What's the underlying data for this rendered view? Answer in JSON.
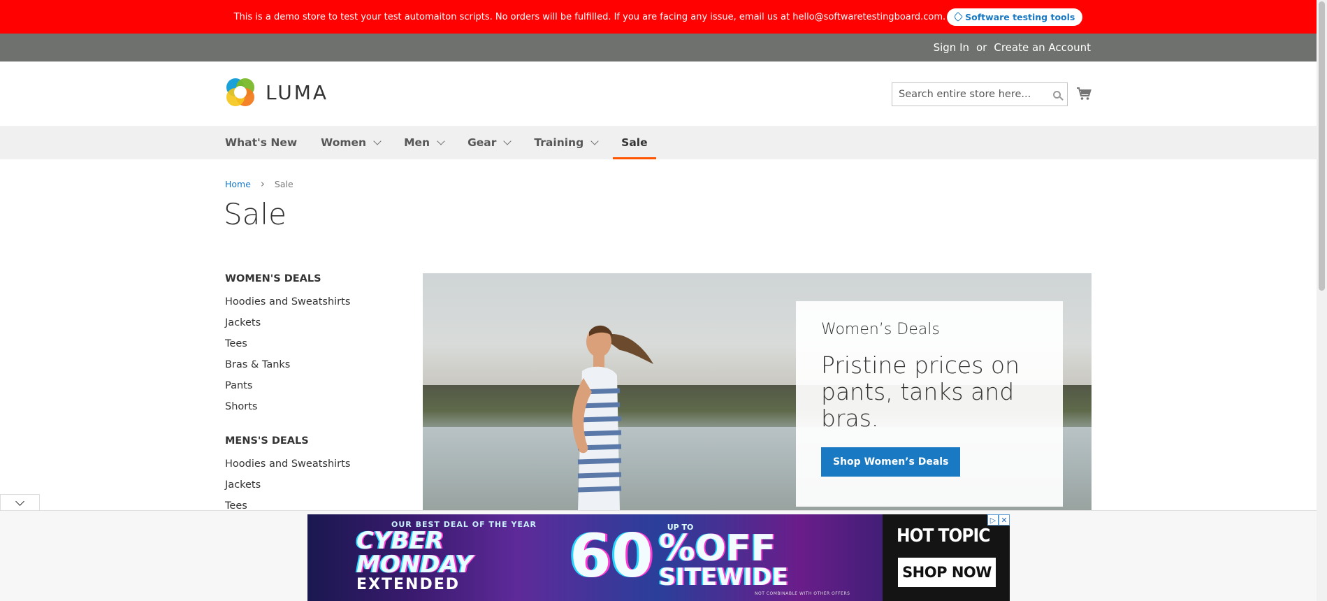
{
  "demo_notice": {
    "text": "This is a demo store to test your test automaiton scripts. No orders will be fulfilled. If you are facing any issue, email us at hello@softwaretestingboard.com.",
    "pill_label": "Software testing tools"
  },
  "panel": {
    "sign_in": "Sign In",
    "or": "or",
    "create_account": "Create an Account"
  },
  "header": {
    "logo_text": "LUMA",
    "search_placeholder": "Search entire store here..."
  },
  "nav": {
    "items": [
      {
        "label": "What's New",
        "has_submenu": false
      },
      {
        "label": "Women",
        "has_submenu": true
      },
      {
        "label": "Men",
        "has_submenu": true
      },
      {
        "label": "Gear",
        "has_submenu": true
      },
      {
        "label": "Training",
        "has_submenu": true
      },
      {
        "label": "Sale",
        "has_submenu": false,
        "active": true
      }
    ]
  },
  "breadcrumb": {
    "home": "Home",
    "separator": "›",
    "current": "Sale"
  },
  "page_title": "Sale",
  "sidebar": {
    "womens": {
      "title": "WOMEN'S DEALS",
      "links": [
        "Hoodies and Sweatshirts",
        "Jackets",
        "Tees",
        "Bras & Tanks",
        "Pants",
        "Shorts"
      ]
    },
    "mens": {
      "title": "MENS'S DEALS",
      "links": [
        "Hoodies and Sweatshirts",
        "Jackets",
        "Tees"
      ]
    }
  },
  "hero": {
    "kicker": "Women’s Deals",
    "headline": "Pristine prices on pants, tanks and bras.",
    "cta": "Shop Women’s Deals"
  },
  "ad": {
    "small_top": "OUR BEST DEAL OF THE YEAR",
    "big_1": "CYBER",
    "big_2": "MONDAY",
    "extended": "EXTENDED",
    "up_to": "UP TO",
    "percent": "60",
    "off": "%OFF",
    "sitewide": "SITEWIDE",
    "fine_print": "NOT COMBINABLE WITH OTHER OFFERS",
    "brand": "HOT TOPIC",
    "shop_now": "SHOP NOW"
  },
  "colors": {
    "demo_bar": "#ff0101",
    "panel": "#6e716e",
    "link_blue": "#1979c3",
    "nav_active_underline": "#ff5501"
  }
}
